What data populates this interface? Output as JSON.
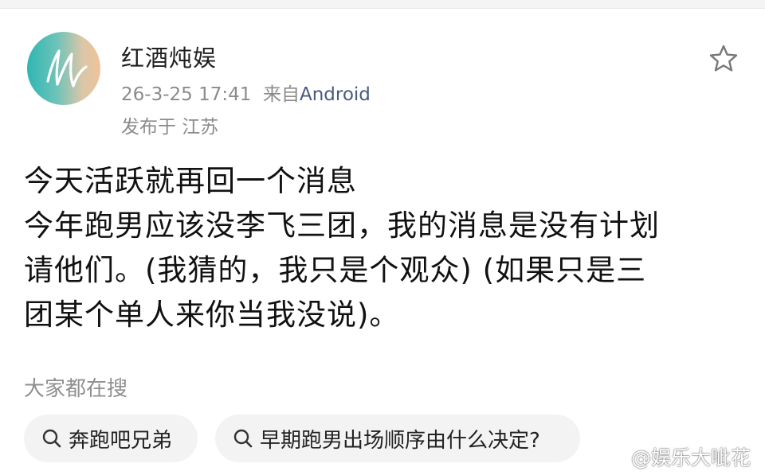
{
  "post": {
    "author": "红酒炖娱",
    "date": "26-3-25 17:41",
    "source_prefix": "来自",
    "source": "Android",
    "location": "发布于 江苏",
    "lines": [
      "今天活跃就再回一个消息",
      "今年跑男应该没李飞三团，我的消息是没有计划",
      "请他们。(我猜的，我只是个观众) (如果只是三",
      "团某个单人来你当我没说)。"
    ]
  },
  "searches": {
    "title": "大家都在搜",
    "items": [
      "奔跑吧兄弟",
      "早期跑男出场顺序由什么决定?"
    ]
  },
  "watermark": "@娱乐大呲花",
  "icons": {
    "favorite": "star-icon",
    "search": "search-icon",
    "weibo": "weibo-logo"
  },
  "colors": {
    "meta": "#8b8b8b",
    "source": "#4a5a80",
    "chip_bg": "#f3f3f3"
  }
}
